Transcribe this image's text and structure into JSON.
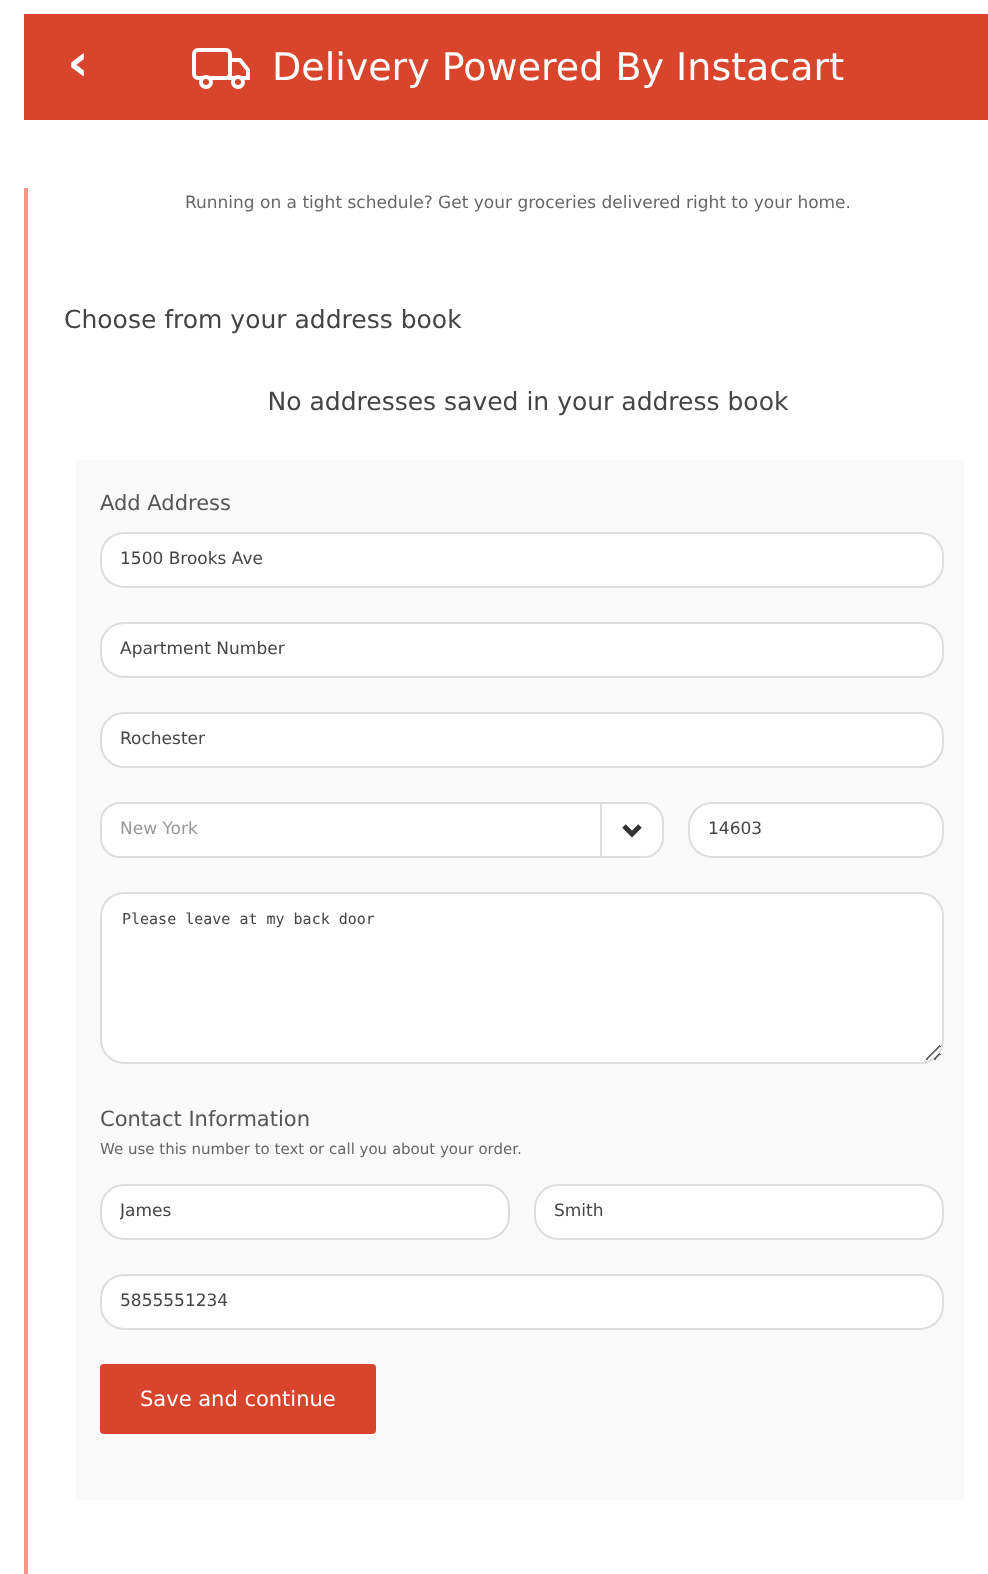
{
  "header": {
    "back": "‹",
    "title": "Delivery Powered By Instacart"
  },
  "tagline": "Running on a tight schedule? Get your groceries delivered right to your home.",
  "address_book": {
    "heading": "Choose from your address book",
    "empty_message": "No addresses saved in your address book"
  },
  "add_address": {
    "heading": "Add Address",
    "street": {
      "value": "1500 Brooks Ave"
    },
    "apartment": {
      "value": "Apartment Number"
    },
    "city": {
      "value": "Rochester"
    },
    "state": {
      "value": "New York"
    },
    "zip": {
      "value": "14603"
    },
    "instructions": {
      "value": "Please leave at my back door"
    }
  },
  "contact": {
    "heading": "Contact Information",
    "note": "We use this number to text or call you about your order.",
    "first_name": {
      "value": "James"
    },
    "last_name": {
      "value": "Smith"
    },
    "phone": {
      "value": "5855551234"
    }
  },
  "save_button": "Save and continue"
}
